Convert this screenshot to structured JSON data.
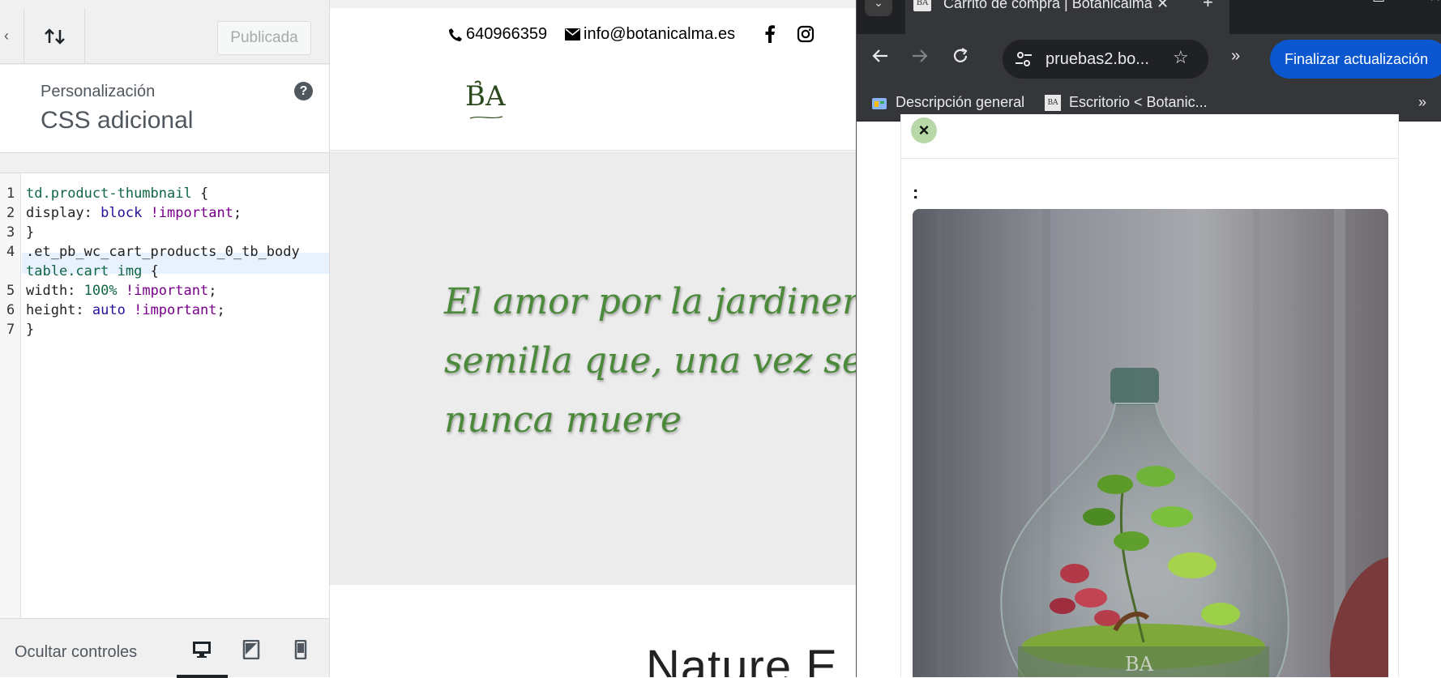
{
  "customizer": {
    "publish_label": "Publicada",
    "section_label": "Personalización",
    "panel_title": "CSS adicional",
    "help_icon": "help-icon",
    "css_lines": [
      {
        "num": "1",
        "text": "td.product-thumbnail {"
      },
      {
        "num": "2",
        "text": "display: block !important;"
      },
      {
        "num": "3",
        "text": "}"
      },
      {
        "num": "4",
        "text": ".et_pb_wc_cart_products_0_tb_body"
      },
      {
        "num": "",
        "text": "table.cart img {"
      },
      {
        "num": "5",
        "text": "width: 100% !important;"
      },
      {
        "num": "6",
        "text": "height: auto !important;"
      },
      {
        "num": "7",
        "text": "}"
      }
    ],
    "hide_controls_label": "Ocultar controles"
  },
  "site": {
    "phone": "640966359",
    "email": "info@botanicalma.es",
    "logo_text": "BA",
    "hero_lines": [
      "El amor por la jardinería es",
      "semilla que, una vez sembra",
      "nunca muere"
    ],
    "section_title": "Nature E"
  },
  "browser": {
    "tab_title": "Carrito de compra | Botanicalma",
    "url": "pruebas2.bo...",
    "update_label": "Finalizar actualización",
    "bookmarks": [
      "Descripción general",
      "Escritorio < Botanic..."
    ],
    "colors": {
      "frame": "#202124",
      "toolbar": "#35363a",
      "accent": "#0b57d0"
    }
  },
  "cart": {
    "remove_symbol": "×",
    "field_label": ":"
  }
}
